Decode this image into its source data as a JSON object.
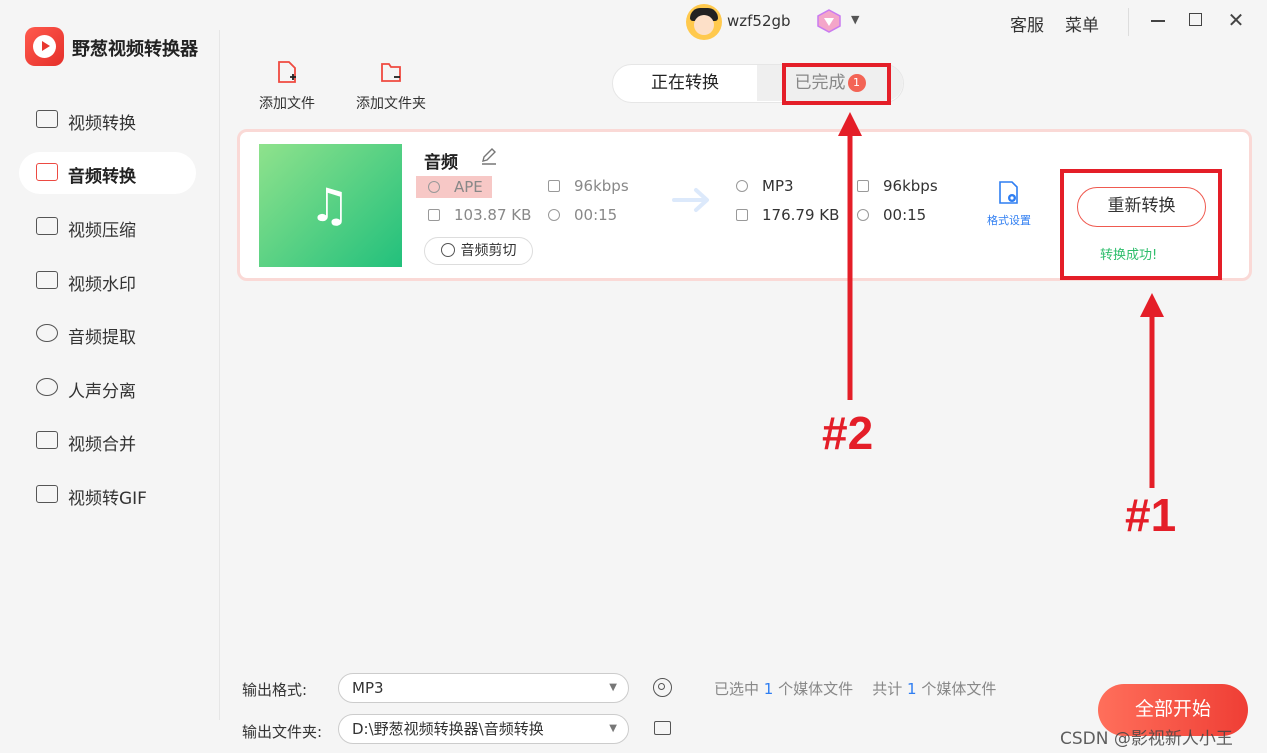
{
  "app": {
    "title": "野葱视频转换器"
  },
  "sidebar": {
    "items": [
      {
        "label": "视频转换",
        "icon": "video-convert-icon",
        "active": false
      },
      {
        "label": "音频转换",
        "icon": "speaker-icon",
        "active": true
      },
      {
        "label": "视频压缩",
        "icon": "video-compress-icon",
        "active": false
      },
      {
        "label": "视频水印",
        "icon": "watermark-icon",
        "active": false
      },
      {
        "label": "音频提取",
        "icon": "microphone-icon",
        "active": false
      },
      {
        "label": "人声分离",
        "icon": "voice-separate-icon",
        "active": false
      },
      {
        "label": "视频合并",
        "icon": "merge-icon",
        "active": false
      },
      {
        "label": "视频转GIF",
        "icon": "gif-icon",
        "active": false
      }
    ]
  },
  "header": {
    "username": "wzf52gb",
    "service": "客服",
    "menu": "菜单"
  },
  "toolbar": {
    "add_file": "添加文件",
    "add_folder": "添加文件夹"
  },
  "tabs": {
    "converting": "正在转换",
    "done": "已完成",
    "done_badge": "1"
  },
  "file": {
    "name": "音频",
    "source": {
      "format": "APE",
      "bitrate": "96kbps",
      "size": "103.87 KB",
      "duration": "00:15"
    },
    "target": {
      "format": "MP3",
      "bitrate": "96kbps",
      "size": "176.79 KB",
      "duration": "00:15"
    },
    "clip_label": "音频剪切",
    "format_settings": "格式设置",
    "reconvert": "重新转换",
    "status": "转换成功!"
  },
  "annotations": {
    "label1": "#1",
    "label2": "#2"
  },
  "bottom": {
    "output_format_label": "输出格式:",
    "output_format_value": "MP3",
    "output_folder_label": "输出文件夹:",
    "output_folder_value": "D:\\野葱视频转换器\\音频转换",
    "selected_prefix": "已选中",
    "selected_count": "1",
    "selected_suffix": "个媒体文件",
    "total_prefix": "共计",
    "total_count": "1",
    "total_suffix": "个媒体文件",
    "start_all": "全部开始"
  },
  "watermark": "CSDN @影视新人小王",
  "colors": {
    "accent": "#ef4a40",
    "annotation": "#e41e28",
    "success": "#2dbd6b",
    "link": "#2f7ef2"
  }
}
